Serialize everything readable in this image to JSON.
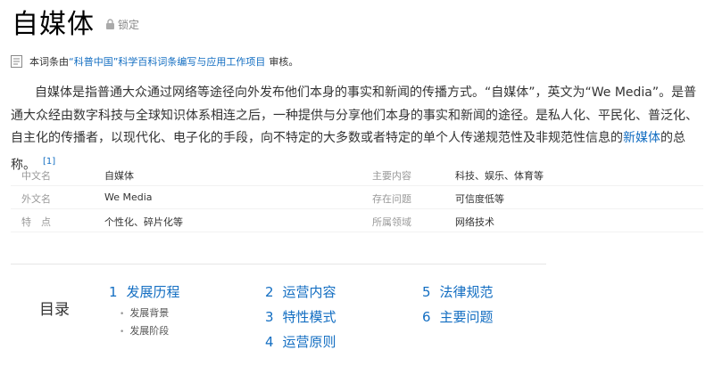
{
  "header": {
    "title": "自媒体",
    "lock_label": "锁定",
    "lock_icon": "lock-icon"
  },
  "review": {
    "icon": "document-icon",
    "prefix": "本词条由",
    "link": "“科普中国”科学百科词条编写与应用工作项目",
    "suffix": "审核。"
  },
  "summary": {
    "part1": "自媒体是指普通大众通过网络等途径向外发布他们本身的事实和新闻的传播方式。“自媒体”，英文为“We Media”。是普通大众经由数字科技与全球知识体系相连之后，一种提供与分享他们本身的事实和新闻的途径。是私人化、平民化、普泛化、自主化的传播者，以现代化、电子化的手段，向不特定的大多数或者特定的单个人传递规范性及非规范性信息的",
    "link": "新媒体",
    "part2": "的总称。",
    "citation": "[1]"
  },
  "infobox": {
    "rows": [
      {
        "k1": "中文名",
        "v1": "自媒体",
        "k2": "主要内容",
        "v2": "科技、娱乐、体育等"
      },
      {
        "k1": "外文名",
        "v1": "We Media",
        "k2": "存在问题",
        "v2": "可信度低等"
      },
      {
        "k1": "特　点",
        "v1": "个性化、碎片化等",
        "k2": "所属领域",
        "v2": "网络技术"
      }
    ]
  },
  "toc": {
    "title": "目录",
    "items": [
      {
        "num": "1",
        "label": "发展历程"
      },
      {
        "num": "2",
        "label": "运营内容"
      },
      {
        "num": "3",
        "label": "特性模式"
      },
      {
        "num": "4",
        "label": "运营原则"
      },
      {
        "num": "5",
        "label": "法律规范"
      },
      {
        "num": "6",
        "label": "主要问题"
      }
    ],
    "subitems": [
      "发展背景",
      "发展阶段"
    ]
  },
  "colors": {
    "link": "#136ec2",
    "muted": "#999999",
    "text": "#333333"
  }
}
